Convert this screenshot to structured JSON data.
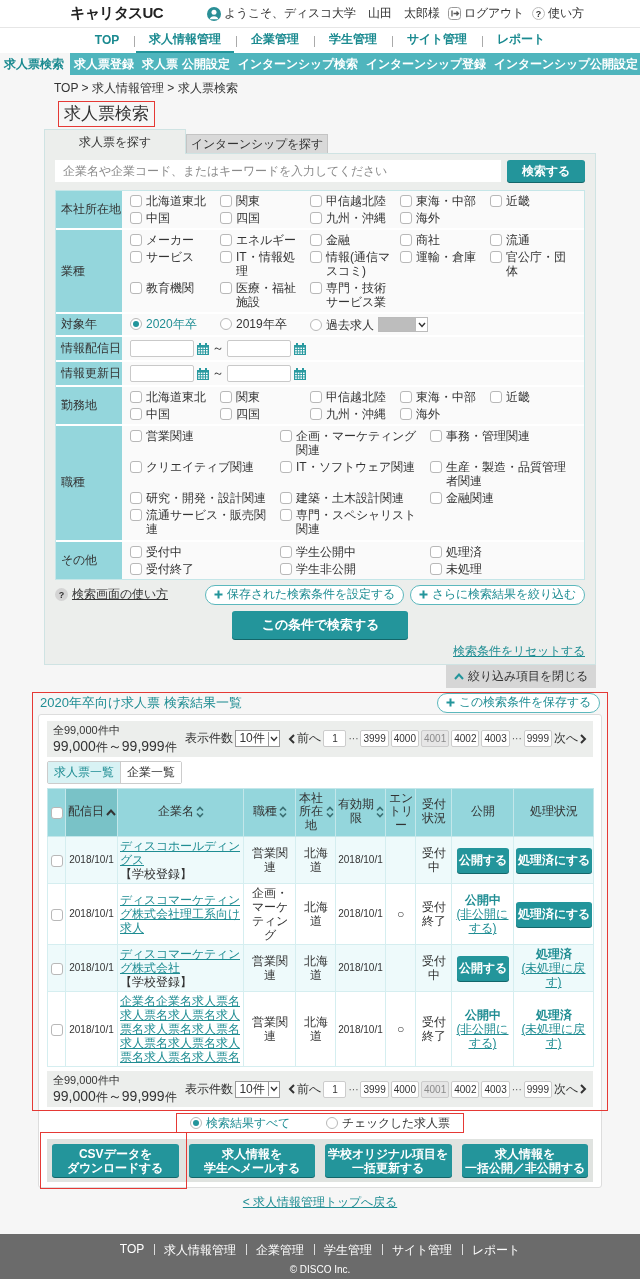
{
  "header": {
    "logo": "キャリタスUC",
    "welcome": "ようこそ、ディスコ大学　山田　太郎様",
    "logout": "ログアウト",
    "help_icon": "?",
    "help": "使い方"
  },
  "main_nav": [
    {
      "label": "TOP",
      "selected": false
    },
    {
      "label": "求人情報管理",
      "selected": true
    },
    {
      "label": "企業管理",
      "selected": false
    },
    {
      "label": "学生管理",
      "selected": false
    },
    {
      "label": "サイト管理",
      "selected": false
    },
    {
      "label": "レポート",
      "selected": false
    }
  ],
  "sub_nav": [
    {
      "label": "求人票検索",
      "selected": true
    },
    {
      "label": "求人票登録",
      "selected": false
    },
    {
      "label": "求人票 公開設定",
      "selected": false
    },
    {
      "label": "インターンシップ検索",
      "selected": false
    },
    {
      "label": "インターンシップ登録",
      "selected": false
    },
    {
      "label": "インターンシップ公開設定",
      "selected": false
    }
  ],
  "breadcrumb": "TOP > 求人情報管理 > 求人票検索",
  "page_title": {
    "text": "求人票検索",
    "highlighted": true
  },
  "search": {
    "tabs": [
      {
        "label": "求人票を探す",
        "selected": true
      },
      {
        "label": "インターンシップを探す",
        "selected": false
      }
    ],
    "keyword": {
      "placeholder": "企業名や企業コード、またはキーワードを入力してください"
    },
    "search_button": "検索する",
    "filters": [
      {
        "label": "本社所在地",
        "kind": "checkboxes-narrow",
        "options": [
          {
            "label": "北海道東北",
            "checked": false
          },
          {
            "label": "関東",
            "checked": false
          },
          {
            "label": "甲信越北陸",
            "checked": false
          },
          {
            "label": "東海・中部",
            "checked": false
          },
          {
            "label": "近畿",
            "checked": false
          },
          {
            "label": "中国",
            "checked": false
          },
          {
            "label": "四国",
            "checked": false
          },
          {
            "label": "九州・沖縄",
            "checked": false
          },
          {
            "label": "海外",
            "checked": false
          }
        ]
      },
      {
        "label": "業種",
        "kind": "checkboxes-narrow",
        "options": [
          {
            "label": "メーカー",
            "checked": false
          },
          {
            "label": "エネルギー",
            "checked": false
          },
          {
            "label": "金融",
            "checked": false
          },
          {
            "label": "商社",
            "checked": false
          },
          {
            "label": "流通",
            "checked": false
          },
          {
            "label": "サービス",
            "checked": false
          },
          {
            "label": "IT・情報処理",
            "checked": false
          },
          {
            "label": "情報(通信マスコミ)",
            "checked": false
          },
          {
            "label": "運輸・倉庫",
            "checked": false
          },
          {
            "label": "官公庁・団体",
            "checked": false
          },
          {
            "label": "教育機関",
            "checked": false
          },
          {
            "label": "医療・福祉施設",
            "checked": false
          },
          {
            "label": "専門・技術サービス業",
            "checked": false
          }
        ]
      },
      {
        "label": "対象年",
        "kind": "radios",
        "options": [
          {
            "label": "2020年卒",
            "selected": true
          },
          {
            "label": "2019年卒",
            "selected": false
          },
          {
            "label": "過去求人",
            "selected": false
          }
        ],
        "year_select": {
          "disabled": true
        }
      },
      {
        "label": "情報配信日",
        "kind": "daterange",
        "separator": "～"
      },
      {
        "label": "情報更新日",
        "kind": "daterange",
        "separator": "～"
      },
      {
        "label": "勤務地",
        "kind": "checkboxes-narrow",
        "options": [
          {
            "label": "北海道東北",
            "checked": false
          },
          {
            "label": "関東",
            "checked": false
          },
          {
            "label": "甲信越北陸",
            "checked": false
          },
          {
            "label": "東海・中部",
            "checked": false
          },
          {
            "label": "近畿",
            "checked": false
          },
          {
            "label": "中国",
            "checked": false
          },
          {
            "label": "四国",
            "checked": false
          },
          {
            "label": "九州・沖縄",
            "checked": false
          },
          {
            "label": "海外",
            "checked": false
          }
        ]
      },
      {
        "label": "職種",
        "kind": "checkboxes-wide",
        "options": [
          {
            "label": "営業関連",
            "checked": false
          },
          {
            "label": "企画・マーケティング関連",
            "checked": false
          },
          {
            "label": "事務・管理関連",
            "checked": false
          },
          {
            "label": "クリエイティブ関連",
            "checked": false
          },
          {
            "label": "IT・ソフトウェア関連",
            "checked": false
          },
          {
            "label": "生産・製造・品質管理者関連",
            "checked": false
          },
          {
            "label": "研究・開発・設計関連",
            "checked": false
          },
          {
            "label": "建築・土木設計関連",
            "checked": false
          },
          {
            "label": "金融関連",
            "checked": false
          },
          {
            "label": "流通サービス・販売関連",
            "checked": false
          },
          {
            "label": "専門・スペシャリスト関連",
            "checked": false
          }
        ]
      },
      {
        "label": "その他",
        "kind": "checkboxes-wide",
        "options": [
          {
            "label": "受付中",
            "checked": false
          },
          {
            "label": "学生公開中",
            "checked": false
          },
          {
            "label": "処理済",
            "checked": false
          },
          {
            "label": "受付終了",
            "checked": false
          },
          {
            "label": "学生非公開",
            "checked": false
          },
          {
            "label": "未処理",
            "checked": false
          }
        ]
      }
    ],
    "help_icon": "?",
    "help_link": "検索画面の使い方",
    "saved_conditions": "保存された検索条件を設定する",
    "refine": "さらに検索結果を絞り込む",
    "submit": "この条件で検索する",
    "reset": "検索条件をリセットする",
    "collapse": "絞り込み項目を閉じる"
  },
  "results": {
    "highlighted": true,
    "title": "2020年卒向け求人票 検索結果一覧",
    "save": "この検索条件を保存する",
    "pager_top": {
      "total": "全99,000件中",
      "from": "99,000",
      "from_unit": "件",
      "sep": "～",
      "to": "99,999",
      "to_unit": "件",
      "per_page_label": "表示件数",
      "per_page": "10件",
      "prev": "前へ",
      "next": "次へ",
      "pages": [
        {
          "label": "1",
          "kind": "page",
          "selected": false
        },
        {
          "label": "···",
          "kind": "gap"
        },
        {
          "label": "3999",
          "kind": "page",
          "selected": false
        },
        {
          "label": "4000",
          "kind": "page",
          "selected": false
        },
        {
          "label": "4001",
          "kind": "page",
          "selected": true
        },
        {
          "label": "4002",
          "kind": "page",
          "selected": false
        },
        {
          "label": "4003",
          "kind": "page",
          "selected": false
        },
        {
          "label": "···",
          "kind": "gap"
        },
        {
          "label": "9999",
          "kind": "page",
          "selected": false
        }
      ]
    },
    "view_tabs": [
      {
        "label": "求人票一覧",
        "selected": true
      },
      {
        "label": "企業一覧",
        "selected": false
      }
    ],
    "table": {
      "columns": [
        {
          "kind": "checkbox",
          "checked": false
        },
        {
          "kind": "text",
          "label": "配信日",
          "sortable": true,
          "selected": true
        },
        {
          "kind": "text",
          "label": "企業名",
          "sortable": true,
          "selected": false
        },
        {
          "kind": "text",
          "label": "職種",
          "sortable": true,
          "selected": false
        },
        {
          "kind": "text",
          "label": "本社所在地",
          "sortable": true,
          "selected": false
        },
        {
          "kind": "text",
          "label": "有効期限",
          "sortable": true,
          "selected": false
        },
        {
          "kind": "text",
          "label": "エントリー",
          "sortable": false,
          "selected": false
        },
        {
          "kind": "text",
          "label": "受付状況",
          "sortable": false,
          "selected": false
        },
        {
          "kind": "text",
          "label": "公開",
          "sortable": false,
          "selected": false
        },
        {
          "kind": "text",
          "label": "処理状況",
          "sortable": false,
          "selected": false
        }
      ],
      "rows": [
        {
          "checked": false,
          "date": "2018/10/1",
          "company": {
            "link": "ディスコホールディングス",
            "suffix": "【学校登録】"
          },
          "job": "営業関連",
          "location": "北海道",
          "expiry": "2018/10/1",
          "status": "受付中",
          "publish": {
            "kind": "button",
            "label": "公開する"
          },
          "process": {
            "kind": "button",
            "label": "処理済にする"
          }
        },
        {
          "checked": false,
          "date": "2018/10/1",
          "company": {
            "link": "ディスコマーケティング株式会社理工系向け求人"
          },
          "job": "企画・マーケティング",
          "location": "北海道",
          "expiry": "2018/10/1",
          "entry": "○",
          "status": "受付終了",
          "publish": {
            "kind": "status",
            "label": "公開中",
            "link": "(非公開にする)"
          },
          "process": {
            "kind": "button",
            "label": "処理済にする"
          }
        },
        {
          "checked": false,
          "date": "2018/10/1",
          "company": {
            "link": "ディスコマーケティング株式会社",
            "suffix": "【学校登録】"
          },
          "job": "営業関連",
          "location": "北海道",
          "expiry": "2018/10/1",
          "status": "受付中",
          "publish": {
            "kind": "button",
            "label": "公開する"
          },
          "process": {
            "kind": "status",
            "label": "処理済",
            "link": "(未処理に戻す)"
          }
        },
        {
          "checked": false,
          "date": "2018/10/1",
          "company": {
            "link": "企業名企業名求人票名求人票名求人票名求人票名求人票名求人票名求人票名求人票名求人票名求人票名求人票名"
          },
          "job": "営業関連",
          "location": "北海道",
          "expiry": "2018/10/1",
          "entry": "○",
          "status": "受付終了",
          "publish": {
            "kind": "status",
            "label": "公開中",
            "link": "(非公開にする)"
          },
          "process": {
            "kind": "status",
            "label": "処理済",
            "link": "(未処理に戻す)"
          }
        }
      ]
    },
    "pager_bottom": {
      "total": "全99,000件中",
      "from": "99,000",
      "from_unit": "件",
      "sep": "～",
      "to": "99,999",
      "to_unit": "件",
      "per_page_label": "表示件数",
      "per_page": "10件",
      "prev": "前へ",
      "next": "次へ",
      "pages": [
        {
          "label": "1",
          "kind": "page",
          "selected": false
        },
        {
          "label": "···",
          "kind": "gap"
        },
        {
          "label": "3999",
          "kind": "page",
          "selected": false
        },
        {
          "label": "4000",
          "kind": "page",
          "selected": false
        },
        {
          "label": "4001",
          "kind": "page",
          "selected": true
        },
        {
          "label": "4002",
          "kind": "page",
          "selected": false
        },
        {
          "label": "4003",
          "kind": "page",
          "selected": false
        },
        {
          "label": "···",
          "kind": "gap"
        },
        {
          "label": "9999",
          "kind": "page",
          "selected": false
        }
      ]
    },
    "scope": {
      "highlighted": true,
      "options": [
        {
          "label": "検索結果すべて",
          "selected": true
        },
        {
          "label": "チェックした求人票",
          "selected": false
        }
      ]
    },
    "actions": [
      {
        "lines": [
          "CSVデータを",
          "ダウンロードする"
        ],
        "highlighted": true
      },
      {
        "lines": [
          "求人情報を",
          "学生へメールする"
        ],
        "highlighted": false
      },
      {
        "lines": [
          "学校オリジナル項目を",
          "一括更新する"
        ],
        "highlighted": false
      },
      {
        "lines": [
          "求人情報を",
          "一括公開／非公開する"
        ],
        "highlighted": false
      }
    ]
  },
  "back_link": "< 求人情報管理トップへ戻る",
  "footer": {
    "links": [
      "TOP",
      "求人情報管理",
      "企業管理",
      "学生管理",
      "サイト管理",
      "レポート"
    ],
    "copyright": "© DISCO Inc."
  }
}
